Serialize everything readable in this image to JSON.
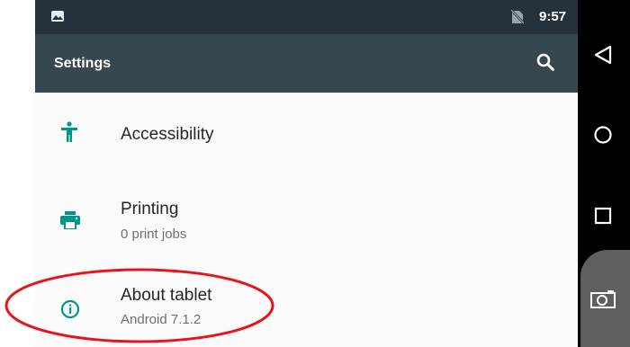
{
  "status_bar": {
    "time": "9:57",
    "icons": [
      "image-icon",
      "no-sim-icon"
    ]
  },
  "app_bar": {
    "title": "Settings",
    "search_icon": "search-icon"
  },
  "settings_items": [
    {
      "label": "Accessibility",
      "subtitle": "",
      "icon": "accessibility-icon",
      "icon_color": "#009688"
    },
    {
      "label": "Printing",
      "subtitle": "0 print jobs",
      "icon": "print-icon",
      "icon_color": "#009688"
    },
    {
      "label": "About tablet",
      "subtitle": "Android 7.1.2",
      "icon": "info-icon",
      "icon_color": "#009688"
    }
  ],
  "nav_bar": {
    "buttons": [
      "back-icon",
      "home-icon",
      "recents-icon",
      "screenshot-icon"
    ]
  },
  "colors": {
    "status_bar": "#26323b",
    "app_bar": "#37474f",
    "content_bg": "#fafafa",
    "accent": "#009688",
    "annotation": "#e8141b"
  }
}
